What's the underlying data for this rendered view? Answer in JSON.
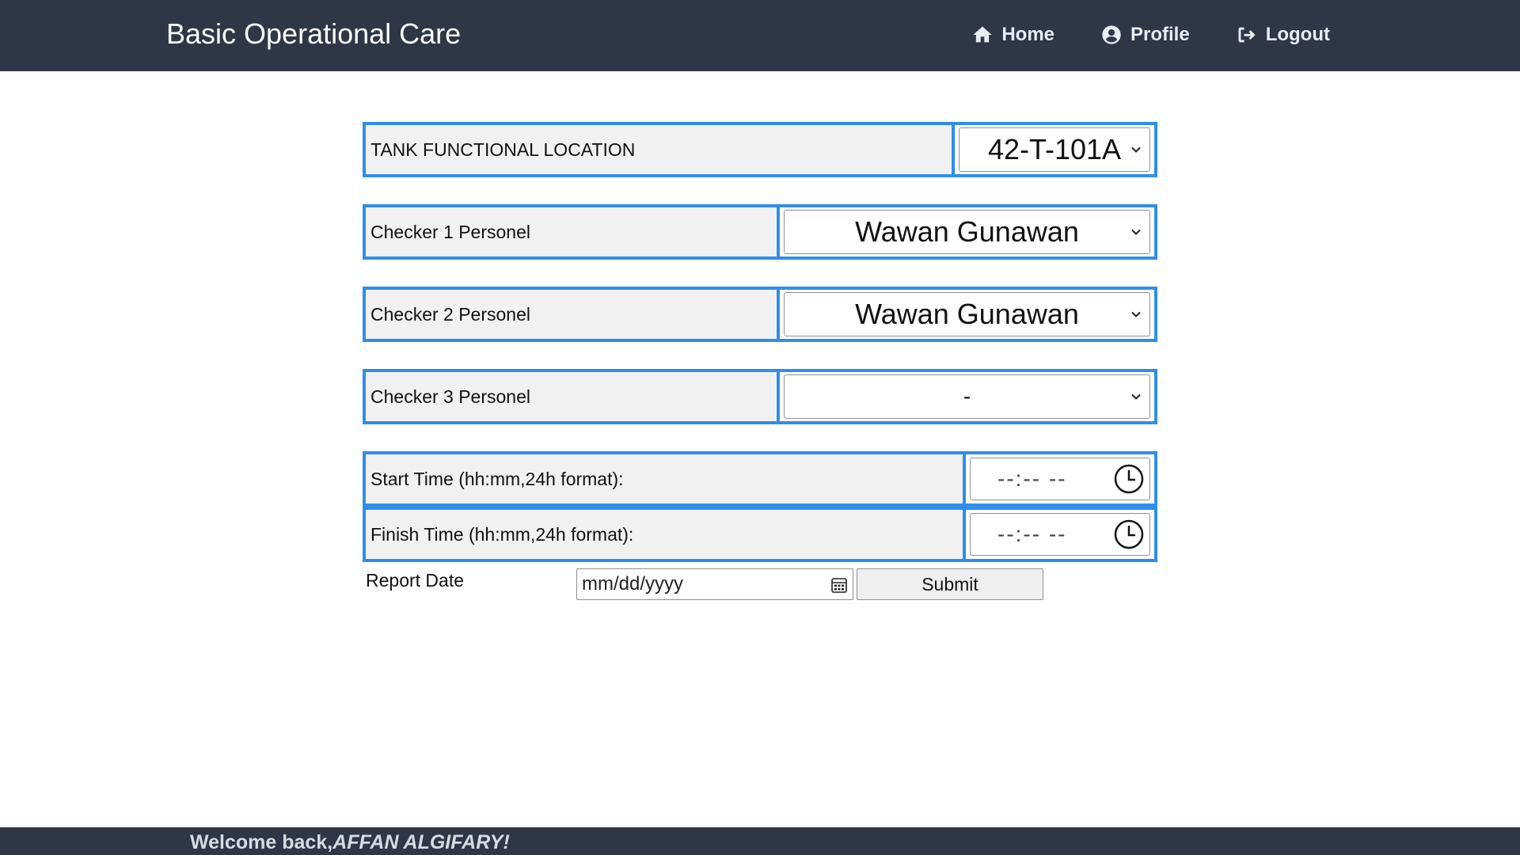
{
  "header": {
    "brand": "Basic Operational Care",
    "nav": [
      {
        "label": "Home",
        "icon": "home-icon"
      },
      {
        "label": "Profile",
        "icon": "user-circle-icon"
      },
      {
        "label": "Logout",
        "icon": "logout-icon"
      }
    ]
  },
  "form": {
    "tank": {
      "label": "TANK FUNCTIONAL LOCATION",
      "value": "42-T-101A"
    },
    "checker1": {
      "label": "Checker 1 Personel",
      "value": "Wawan Gunawan"
    },
    "checker2": {
      "label": "Checker 2 Personel",
      "value": "Wawan Gunawan"
    },
    "checker3": {
      "label": "Checker 3 Personel",
      "value": "-"
    },
    "start_time": {
      "label": "Start Time (hh:mm,24h format):",
      "value": "--:-- --"
    },
    "finish_time": {
      "label": "Finish Time (hh:mm,24h format):",
      "value": "--:-- --"
    },
    "report_date": {
      "label": "Report Date",
      "placeholder": "mm/dd/yyyy"
    },
    "submit_label": "Submit"
  },
  "footer": {
    "welcome_prefix": "Welcome back,",
    "user_name": "AFFAN ALGIFARY!"
  },
  "colors": {
    "topbar": "#2e3746",
    "border_accent": "#2f8eeb",
    "label_bg": "#f1f1f1"
  }
}
